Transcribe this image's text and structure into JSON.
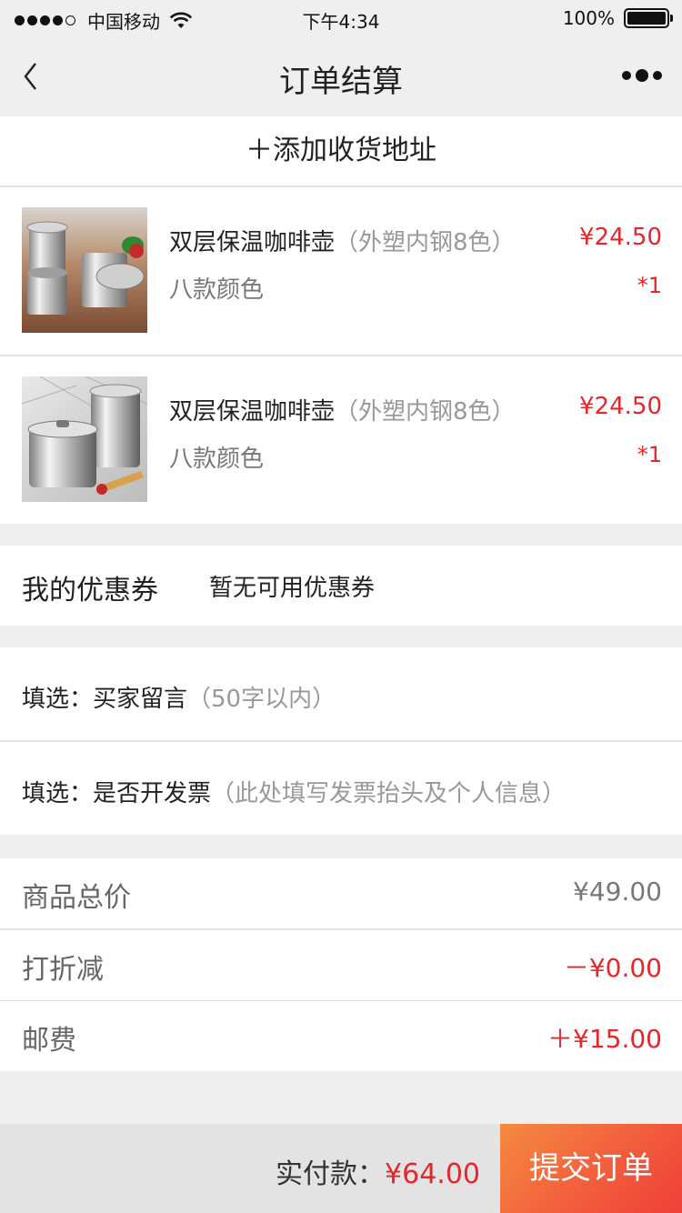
{
  "status_bar": {
    "carrier": "中国移动",
    "time": "下午4:34",
    "battery": "100%",
    "signal_icon": "signal-dots-icon",
    "wifi_icon": "wifi-icon",
    "battery_icon": "battery-icon"
  },
  "nav": {
    "title": "订单结算",
    "back_icon": "chevron-left-icon",
    "more_icon": "more-dots-icon"
  },
  "address": {
    "add_label": "＋添加收货地址"
  },
  "products": [
    {
      "name": "双层保温咖啡壶",
      "spec": "（外塑内钢8色）",
      "color": "八款颜色",
      "price": "¥24.50",
      "qty": "*1"
    },
    {
      "name": "双层保温咖啡壶",
      "spec": "（外塑内钢8色）",
      "color": "八款颜色",
      "price": "¥24.50",
      "qty": "*1"
    }
  ],
  "coupon": {
    "label": "我的优惠券",
    "value": "暂无可用优惠券"
  },
  "options": {
    "message_label": "填选：买家留言",
    "message_placeholder": "（50字以内）",
    "invoice_label": "填选：是否开发票",
    "invoice_placeholder": "（此处填写发票抬头及个人信息）"
  },
  "summary": {
    "total_label": "商品总价",
    "total_value": "¥49.00",
    "discount_label": "打折减",
    "discount_value": "－¥0.00",
    "shipping_label": "邮费",
    "shipping_value": "＋¥15.00"
  },
  "checkout": {
    "pay_label": "实付款：",
    "pay_amount": "¥64.00",
    "submit_label": "提交订单"
  },
  "colors": {
    "accent_red": "#e5262b",
    "submit_gradient_start": "#f58a41",
    "submit_gradient_end": "#ef3f39",
    "page_background": "#efefef"
  }
}
